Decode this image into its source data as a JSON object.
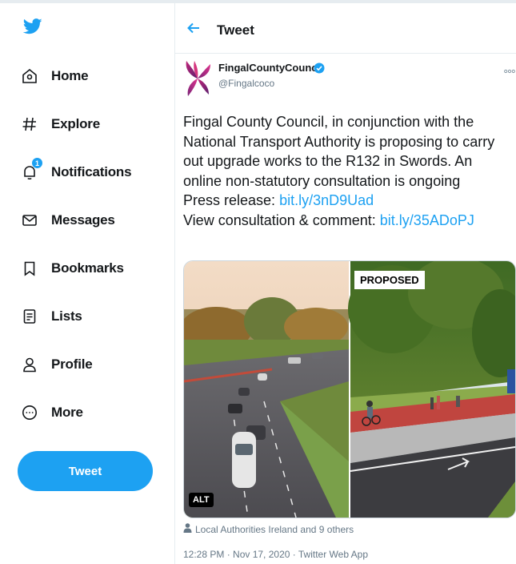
{
  "colors": {
    "accent": "#1da1f2",
    "text": "#14171a",
    "muted": "#657786",
    "border": "#e6ecf0"
  },
  "sidebar": {
    "logo_icon": "twitter-bird-icon",
    "items": [
      {
        "label": "Home",
        "icon": "home-icon"
      },
      {
        "label": "Explore",
        "icon": "hashtag-icon"
      },
      {
        "label": "Notifications",
        "icon": "bell-icon",
        "badge": "1"
      },
      {
        "label": "Messages",
        "icon": "envelope-icon"
      },
      {
        "label": "Bookmarks",
        "icon": "bookmark-icon"
      },
      {
        "label": "Lists",
        "icon": "list-icon"
      },
      {
        "label": "Profile",
        "icon": "person-icon"
      },
      {
        "label": "More",
        "icon": "more-circle-icon"
      }
    ],
    "tweet_button": "Tweet"
  },
  "header": {
    "title": "Tweet",
    "back_icon": "arrow-left-icon"
  },
  "tweet": {
    "author_name": "FingalCountyCouncil",
    "handle": "@Fingalcoco",
    "verified": true,
    "text": "Fingal County Council, in conjunction with the National Transport Authority is proposing to carry out upgrade works to the R132 in Swords. An online non-statutory consultation is ongoing",
    "press_label": "Press release: ",
    "press_link": "bit.ly/3nD9Uad",
    "consult_label": "View consultation & comment: ",
    "consult_link": "bit.ly/35ADoPJ",
    "media": {
      "alt_badge": "ALT",
      "proposed_badge": "PROPOSED"
    },
    "tagged_text": "Local Authorities Ireland and 9 others",
    "timestamp": "12:28 PM · Nov 17, 2020 · Twitter Web App"
  }
}
